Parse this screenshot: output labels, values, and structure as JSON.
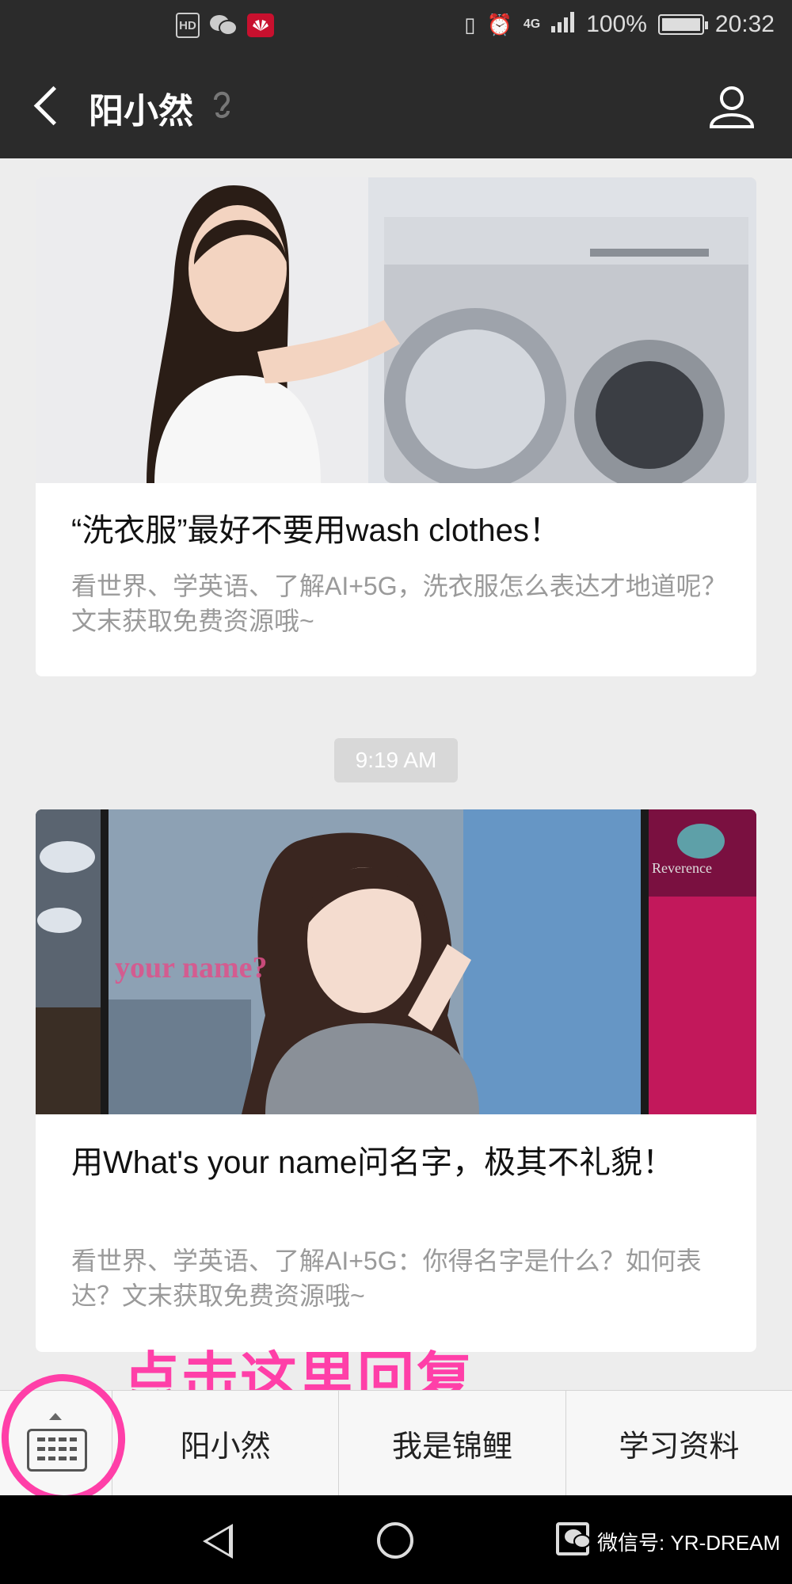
{
  "status_bar": {
    "left_icons": [
      "hd-icon",
      "wechat-icon",
      "huawei-icon"
    ],
    "hd_label": "HD",
    "network": "4G",
    "battery": "100%",
    "time": "20:32"
  },
  "header": {
    "title": "阳小然",
    "back_icon": "chevron-left-icon",
    "ear_icon": "ear-icon",
    "profile_icon": "person-icon"
  },
  "articles": [
    {
      "image": "woman-leaning-on-washing-machine",
      "title": "“洗衣服”最好不要用wash clothes！",
      "description": "看世界、学英语、了解AI+5G，洗衣服怎么表达才地道呢？文末获取免费资源哦~"
    },
    {
      "image": "woman-portrait-with-your-name-text",
      "overlay_text": "your name?",
      "side_text": "Reverence",
      "title": "用What's your name问名字，极其不礼貌！",
      "description": "看世界、学英语、了解AI+5G：你得名字是什么？如何表达？文末获取免费资源哦~"
    }
  ],
  "timestamp": "9:19 AM",
  "annotation": "点击这里回复",
  "menu": {
    "keyboard_icon": "keyboard-icon",
    "items": [
      "阳小然",
      "我是锦鲤",
      "学习资料"
    ]
  },
  "system_nav": {
    "watermark": "微信号: YR-DREAM"
  },
  "colors": {
    "header_bg": "#2b2b2b",
    "annotation": "#ff3fa8",
    "chat_bg": "#ededed"
  }
}
